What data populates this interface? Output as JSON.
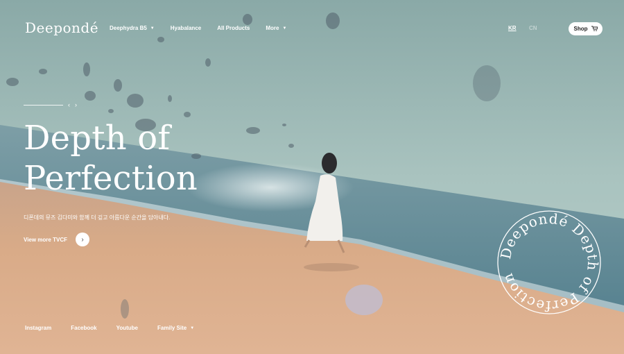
{
  "brand": {
    "logo": "Deepondé"
  },
  "nav": {
    "items": [
      {
        "label": "Deephydra B5",
        "has_dropdown": true
      },
      {
        "label": "Hyabalance",
        "has_dropdown": false
      },
      {
        "label": "All Products",
        "has_dropdown": false
      },
      {
        "label": "More",
        "has_dropdown": true
      }
    ]
  },
  "lang": {
    "kr": "KR",
    "cn": "CN",
    "active": "KR"
  },
  "shop": {
    "label": "Shop",
    "icon": "cart-icon"
  },
  "hero": {
    "title_line1": "Depth of",
    "title_line2": "Perfection",
    "description": "디폰데의 뮤즈 김다미와 함께 더 깊고 아름다운 순간을 담아내다.",
    "cta_label": "View more TVCF",
    "slider_prev_icon": "chevron-left-icon",
    "slider_next_icon": "chevron-right-icon"
  },
  "badge": {
    "text": "Deepondé Depth of Perfection"
  },
  "footer": {
    "links": [
      {
        "label": "Instagram"
      },
      {
        "label": "Facebook"
      },
      {
        "label": "Youtube"
      },
      {
        "label": "Family Site",
        "has_dropdown": true
      }
    ]
  },
  "colors": {
    "sky": "#9bb8b3",
    "sea": "#5f8a95",
    "sand": "#d9ad8c",
    "text": "#ffffff"
  }
}
